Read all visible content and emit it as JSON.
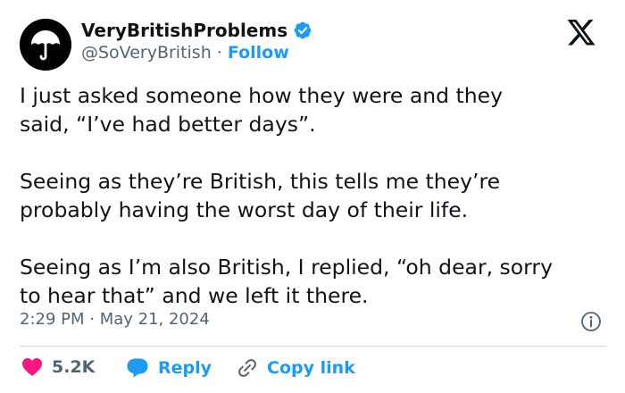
{
  "author": {
    "display_name": "VeryBritishProblems",
    "handle": "@SoVeryBritish",
    "separator": "·",
    "follow_label": "Follow",
    "verified": true
  },
  "tweet": {
    "paragraphs": [
      [
        "I just asked someone how they were and they",
        "said, “I’ve had better days”."
      ],
      [
        "Seeing as they’re British, this tells me they’re",
        "probably having the worst day of their life."
      ],
      [
        "Seeing as I’m also British, I replied, “oh dear, sorry",
        "to hear that” and we left it there."
      ]
    ],
    "timestamp": "2:29 PM · May 21, 2024"
  },
  "actions": {
    "likes_count": "5.2K",
    "reply_label": "Reply",
    "copy_link_label": "Copy link"
  },
  "colors": {
    "text": "#0f1419",
    "secondary": "#536471",
    "link": "#1d9bf0",
    "heart": "#f91880",
    "divider": "#cfd9de"
  },
  "icons": {
    "avatar": "umbrella-icon",
    "verified": "verified-badge-icon",
    "brand": "x-logo-icon",
    "info": "info-icon",
    "like": "heart-icon",
    "reply": "speech-bubble-icon",
    "copy": "link-icon"
  }
}
